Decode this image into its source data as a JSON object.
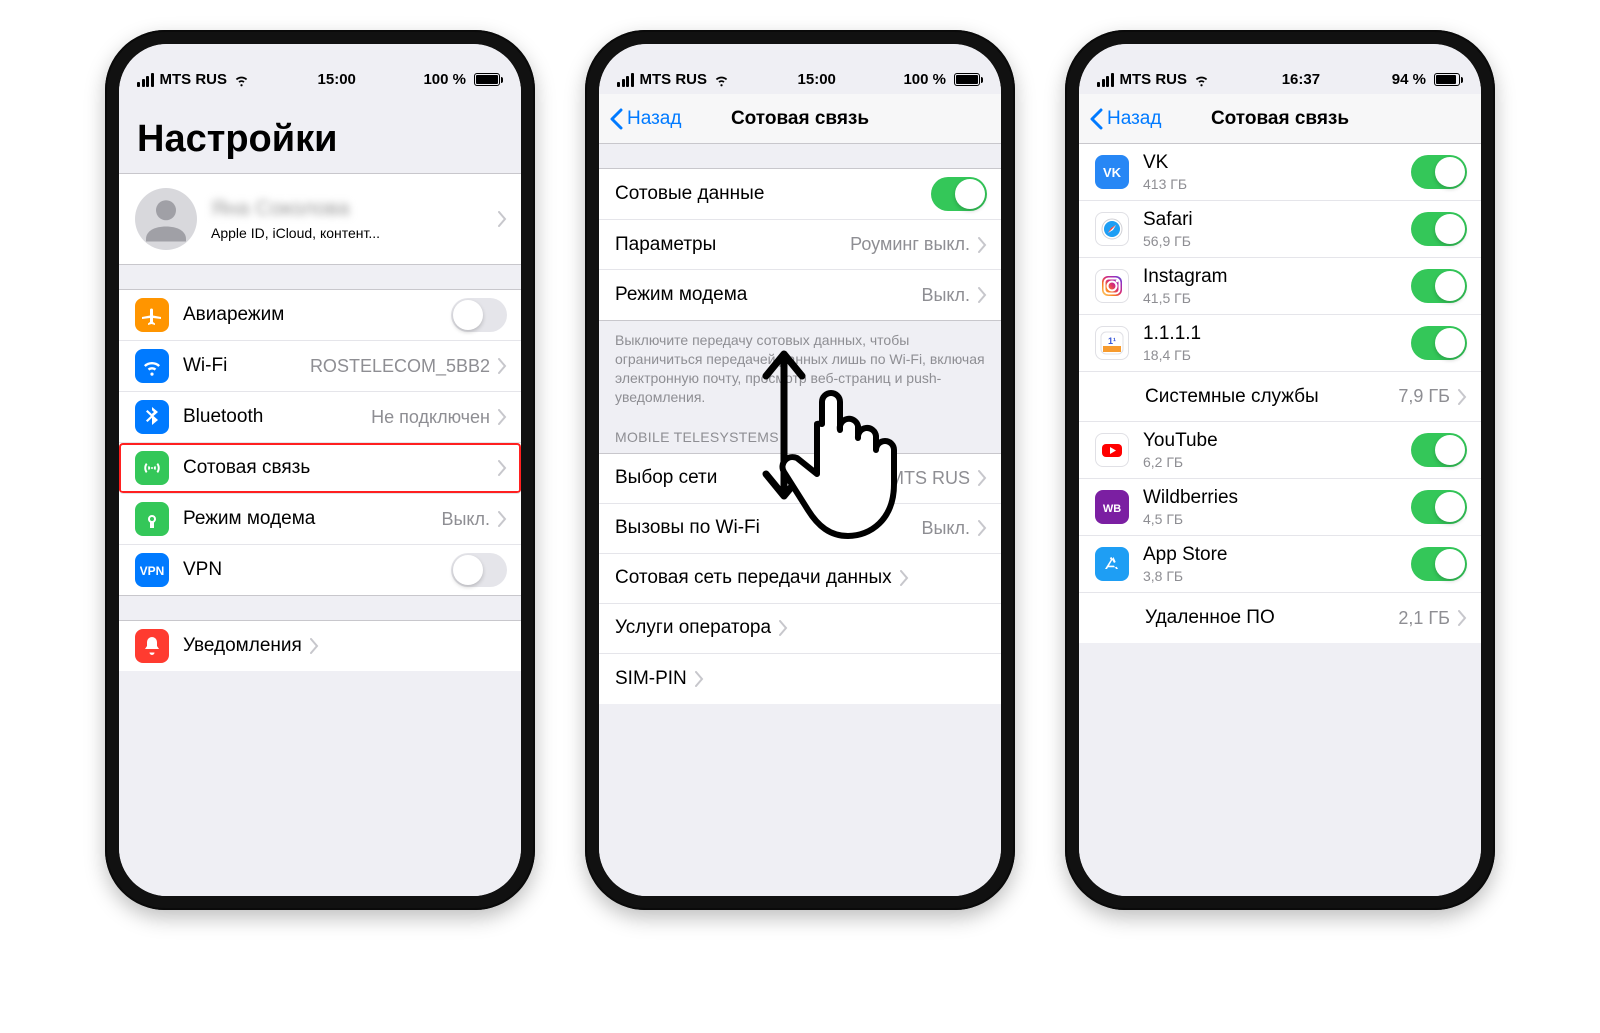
{
  "phone1": {
    "status": {
      "carrier": "MTS RUS",
      "time": "15:00",
      "battery": "100 %",
      "battFill": "100%"
    },
    "title": "Настройки",
    "profile": {
      "name": "Яна Соколова",
      "sub": "Apple ID, iCloud, контент..."
    },
    "rows": [
      {
        "icon": "airplane",
        "bg": "#ff9500",
        "label": "Авиарежим",
        "kind": "toggle",
        "on": false
      },
      {
        "icon": "wifi",
        "bg": "#007aff",
        "label": "Wi-Fi",
        "value": "ROSTELECOM_5BB2",
        "kind": "link"
      },
      {
        "icon": "bluetooth",
        "bg": "#007aff",
        "label": "Bluetooth",
        "value": "Не подключен",
        "kind": "link"
      },
      {
        "icon": "antenna",
        "bg": "#34c759",
        "label": "Сотовая связь",
        "value": "",
        "kind": "link",
        "hl": true
      },
      {
        "icon": "hotspot",
        "bg": "#34c759",
        "label": "Режим модема",
        "value": "Выкл.",
        "kind": "link"
      },
      {
        "icon": "vpn",
        "bg": "#007aff",
        "label": "VPN",
        "kind": "toggle",
        "on": false
      }
    ],
    "rows2": [
      {
        "icon": "bell",
        "bg": "#ff3b30",
        "label": "Уведомления",
        "kind": "link"
      }
    ]
  },
  "phone2": {
    "status": {
      "carrier": "MTS RUS",
      "time": "15:00",
      "battery": "100 %",
      "battFill": "100%"
    },
    "back": "Назад",
    "title": "Сотовая связь",
    "topRows": [
      {
        "label": "Сотовые данные",
        "kind": "toggle",
        "on": true
      },
      {
        "label": "Параметры",
        "value": "Роуминг выкл.",
        "kind": "link"
      },
      {
        "label": "Режим модема",
        "value": "Выкл.",
        "kind": "link"
      }
    ],
    "footer": "Выключите передачу сотовых данных, чтобы ограничиться передачей данных лишь по Wi-Fi, включая электронную почту, просмотр веб-страниц и push-уведомления.",
    "sectionHeader": "MOBILE TELESYSTEMS",
    "rows2": [
      {
        "label": "Выбор сети",
        "value": "MTS RUS",
        "kind": "link"
      },
      {
        "label": "Вызовы по Wi-Fi",
        "value": "Выкл.",
        "kind": "link"
      },
      {
        "label": "Сотовая сеть передачи данных",
        "kind": "link"
      },
      {
        "label": "Услуги оператора",
        "kind": "link"
      },
      {
        "label": "SIM-PIN",
        "kind": "link"
      }
    ]
  },
  "phone3": {
    "status": {
      "carrier": "MTS RUS",
      "time": "16:37",
      "battery": "94 %",
      "battFill": "94%"
    },
    "back": "Назад",
    "title": "Сотовая связь",
    "apps": [
      {
        "icon": "vk",
        "bg": "#2787f5",
        "label": "VK",
        "sub": "413 ГБ",
        "on": true
      },
      {
        "icon": "safari",
        "bg": "#fff",
        "label": "Safari",
        "sub": "56,9 ГБ",
        "on": true
      },
      {
        "icon": "instagram",
        "bg": "#fff",
        "label": "Instagram",
        "sub": "41,5 ГБ",
        "on": true
      },
      {
        "icon": "1111",
        "bg": "#fff",
        "label": "1.1.1.1",
        "sub": "18,4 ГБ",
        "on": true
      }
    ],
    "sysRow": {
      "label": "Системные службы",
      "value": "7,9 ГБ"
    },
    "apps2": [
      {
        "icon": "youtube",
        "bg": "#fff",
        "label": "YouTube",
        "sub": "6,2 ГБ",
        "on": true
      },
      {
        "icon": "wildberries",
        "bg": "#7b1fa2",
        "label": "Wildberries",
        "sub": "4,5 ГБ",
        "on": true
      },
      {
        "icon": "appstore",
        "bg": "#1e9ef4",
        "label": "App Store",
        "sub": "3,8 ГБ",
        "on": true
      }
    ],
    "delRow": {
      "label": "Удаленное ПО",
      "value": "2,1 ГБ"
    }
  }
}
